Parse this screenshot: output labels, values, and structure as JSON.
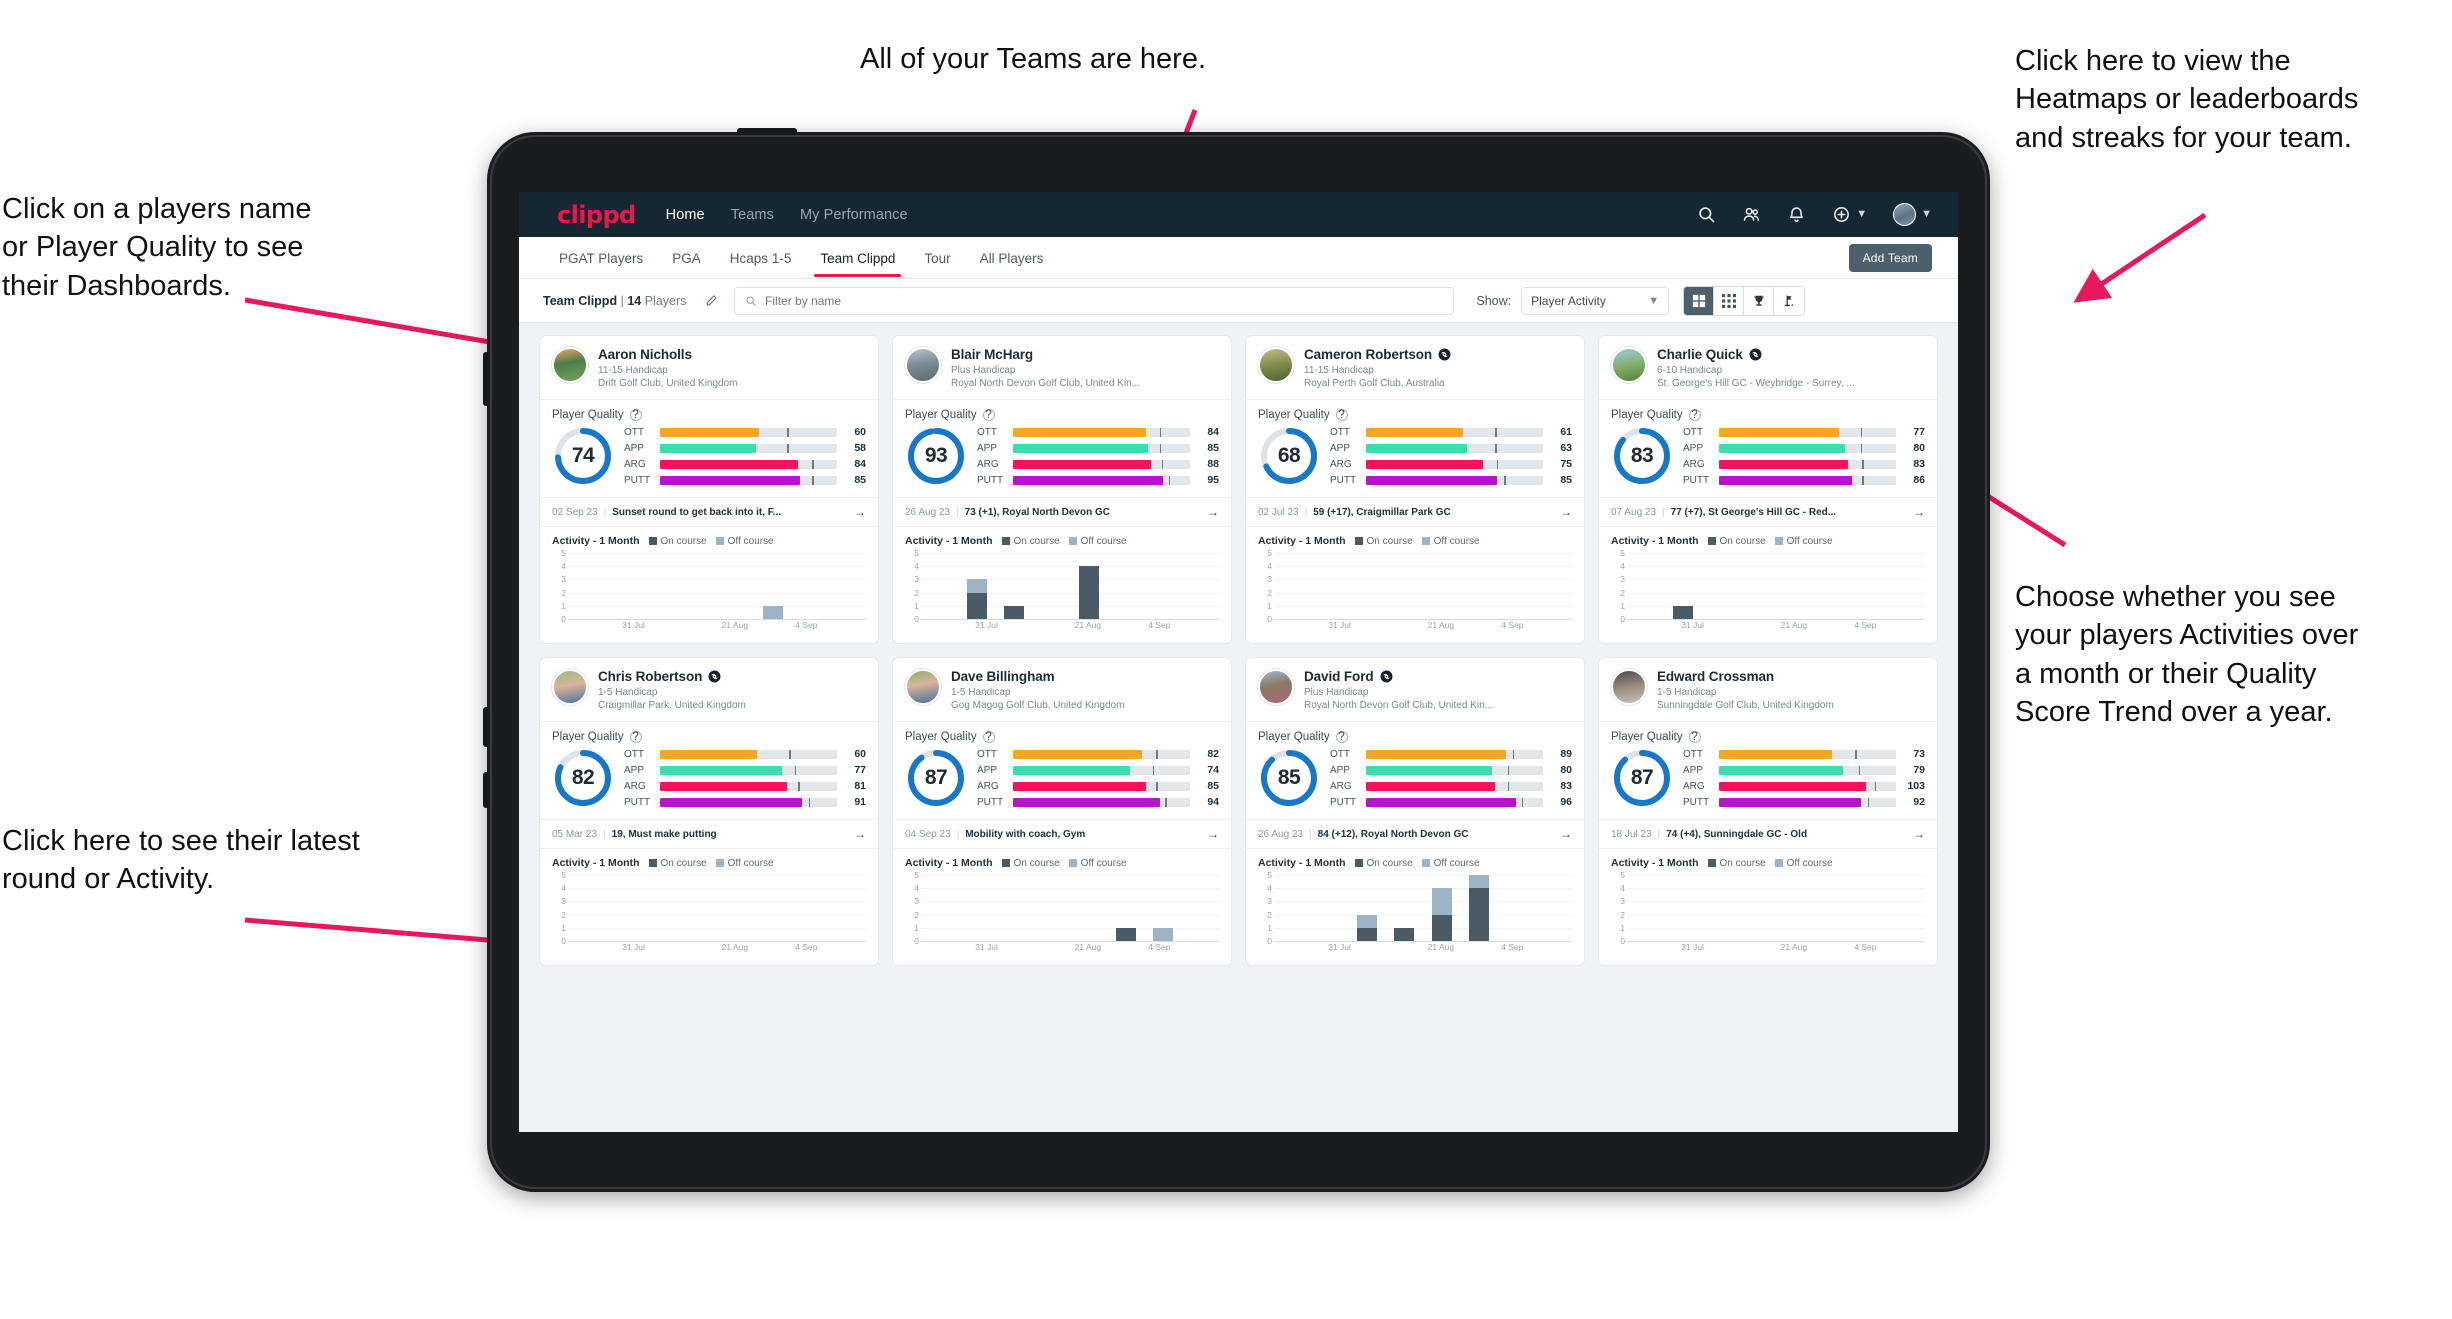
{
  "annotations": [
    {
      "id": "teams",
      "text": "All of your Teams are here."
    },
    {
      "id": "heatmaps",
      "text": "Click here to view the\nHeatmaps or leaderboards\nand streaks for your team."
    },
    {
      "id": "dashboards",
      "text": "Click on a players name\nor Player Quality to see\ntheir Dashboards."
    },
    {
      "id": "show-toggle",
      "text": "Choose whether you see\nyour players Activities over\na month or their Quality\nScore Trend over a year."
    },
    {
      "id": "latest-round",
      "text": "Click here to see their latest\nround or Activity."
    }
  ],
  "colors": {
    "brand": "#e8174c",
    "navbar": "#152733",
    "ott": "#f5a623",
    "app": "#3ddcb0",
    "arg": "#f4145c",
    "putt": "#b316c9",
    "ring": "#1878c8",
    "on_course": "#4a5b66",
    "off_course": "#9db4c6"
  },
  "navbar": {
    "brand": "clippd",
    "links": [
      {
        "label": "Home",
        "active": true
      },
      {
        "label": "Teams",
        "active": false
      },
      {
        "label": "My Performance",
        "active": false
      }
    ],
    "icons": [
      "search-icon",
      "people-icon",
      "bell-icon",
      "plus-circle-icon",
      "avatar"
    ]
  },
  "tabs": [
    {
      "label": "PGAT Players",
      "active": false
    },
    {
      "label": "PGA",
      "active": false
    },
    {
      "label": "Hcaps 1-5",
      "active": false
    },
    {
      "label": "Team Clippd",
      "active": true
    },
    {
      "label": "Tour",
      "active": false
    },
    {
      "label": "All Players",
      "active": false
    }
  ],
  "add_team_label": "Add Team",
  "filterbar": {
    "team_name": "Team Clippd",
    "team_divider": "|",
    "player_count": "14",
    "players_word": "Players",
    "edit_icon": "pencil-icon",
    "search_placeholder": "Filter by name",
    "search_value": "",
    "show_label": "Show:",
    "show_value": "Player Activity",
    "show_options": [
      "Player Activity",
      "Quality Score Trend"
    ],
    "view_buttons": [
      {
        "icon": "grid-large-icon",
        "active": true
      },
      {
        "icon": "grid-dense-icon",
        "active": false
      },
      {
        "icon": "trophy-icon",
        "active": false
      },
      {
        "icon": "heatmap-flag-icon",
        "active": false
      }
    ]
  },
  "card_labels": {
    "player_quality": "Player Quality",
    "help_glyph": "?",
    "activity_title": "Activity - 1 Month",
    "legend_on": "On course",
    "legend_off": "Off course",
    "arrow_glyph": "→"
  },
  "chart_data": {
    "type": "bar",
    "title": "Activity - 1 Month",
    "ylim": [
      0,
      5
    ],
    "yticks": [
      "0",
      "1",
      "2",
      "3",
      "4",
      "5"
    ],
    "xticks": [
      "31 Jul",
      "21 Aug",
      "4 Sep"
    ],
    "legend": [
      "On course",
      "Off course"
    ],
    "grid": true,
    "stacked": true,
    "per_player": [
      {
        "player": "Aaron Nicholls",
        "bins": 8,
        "on": [
          0,
          0,
          0,
          0,
          0,
          0,
          0,
          0
        ],
        "off": [
          0,
          0,
          0,
          0,
          0,
          1,
          0,
          0
        ]
      },
      {
        "player": "Blair McHarg",
        "bins": 8,
        "on": [
          0,
          2,
          1,
          0,
          4,
          0,
          0,
          0
        ],
        "off": [
          0,
          1,
          0,
          0,
          0,
          0,
          0,
          0
        ]
      },
      {
        "player": "Cameron Robertson",
        "bins": 8,
        "on": [
          0,
          0,
          0,
          0,
          0,
          0,
          0,
          0
        ],
        "off": [
          0,
          0,
          0,
          0,
          0,
          0,
          0,
          0
        ]
      },
      {
        "player": "Charlie Quick",
        "bins": 8,
        "on": [
          0,
          1,
          0,
          0,
          0,
          0,
          0,
          0
        ],
        "off": [
          0,
          0,
          0,
          0,
          0,
          0,
          0,
          0
        ]
      },
      {
        "player": "Chris Robertson",
        "bins": 8,
        "on": [
          0,
          0,
          0,
          0,
          0,
          0,
          0,
          0
        ],
        "off": [
          0,
          0,
          0,
          0,
          0,
          0,
          0,
          0
        ]
      },
      {
        "player": "Dave Billingham",
        "bins": 8,
        "on": [
          0,
          0,
          0,
          0,
          0,
          1,
          0,
          0
        ],
        "off": [
          0,
          0,
          0,
          0,
          0,
          0,
          1,
          0
        ]
      },
      {
        "player": "David Ford",
        "bins": 8,
        "on": [
          0,
          0,
          1,
          1,
          2,
          4,
          0,
          0
        ],
        "off": [
          0,
          0,
          1,
          0,
          2,
          1,
          0,
          0
        ]
      },
      {
        "player": "Edward Crossman",
        "bins": 8,
        "on": [
          0,
          0,
          0,
          0,
          0,
          0,
          0,
          0
        ],
        "off": [
          0,
          0,
          0,
          0,
          0,
          0,
          0,
          0
        ]
      }
    ]
  },
  "players": [
    {
      "name": "Aaron Nicholls",
      "verified": false,
      "avatar": "av1",
      "handicap": "11-15 Handicap",
      "club": "Drift Golf Club, United Kingdom",
      "score": 74,
      "ring_pct": 74,
      "metrics": [
        {
          "label": "OTT",
          "value": 60,
          "fill": 56,
          "tick": 72
        },
        {
          "label": "APP",
          "value": 58,
          "fill": 54,
          "tick": 72
        },
        {
          "label": "ARG",
          "value": 84,
          "fill": 78,
          "tick": 86
        },
        {
          "label": "PUTT",
          "value": 85,
          "fill": 79,
          "tick": 86
        }
      ],
      "latest_date": "02 Sep 23",
      "latest_text": "Sunset round to get back into it, F..."
    },
    {
      "name": "Blair McHarg",
      "verified": false,
      "avatar": "av2",
      "handicap": "Plus Handicap",
      "club": "Royal North Devon Golf Club, United Kin...",
      "score": 93,
      "ring_pct": 97,
      "metrics": [
        {
          "label": "OTT",
          "value": 84,
          "fill": 75,
          "tick": 83
        },
        {
          "label": "APP",
          "value": 85,
          "fill": 76,
          "tick": 83
        },
        {
          "label": "ARG",
          "value": 88,
          "fill": 78,
          "tick": 84
        },
        {
          "label": "PUTT",
          "value": 95,
          "fill": 85,
          "tick": 88
        }
      ],
      "latest_date": "26 Aug 23",
      "latest_text": "73 (+1), Royal North Devon GC"
    },
    {
      "name": "Cameron Robertson",
      "verified": true,
      "avatar": "av3",
      "handicap": "11-15 Handicap",
      "club": "Royal Perth Golf Club, Australia",
      "score": 68,
      "ring_pct": 68,
      "metrics": [
        {
          "label": "OTT",
          "value": 61,
          "fill": 55,
          "tick": 73
        },
        {
          "label": "APP",
          "value": 63,
          "fill": 57,
          "tick": 73
        },
        {
          "label": "ARG",
          "value": 75,
          "fill": 66,
          "tick": 74
        },
        {
          "label": "PUTT",
          "value": 85,
          "fill": 74,
          "tick": 78
        }
      ],
      "latest_date": "02 Jul 23",
      "latest_text": "59 (+17), Craigmillar Park GC"
    },
    {
      "name": "Charlie Quick",
      "verified": true,
      "avatar": "av4",
      "handicap": "6-10 Handicap",
      "club": "St. George's Hill GC - Weybridge - Surrey, ...",
      "score": 83,
      "ring_pct": 86,
      "metrics": [
        {
          "label": "OTT",
          "value": 77,
          "fill": 68,
          "tick": 80
        },
        {
          "label": "APP",
          "value": 80,
          "fill": 71,
          "tick": 80
        },
        {
          "label": "ARG",
          "value": 83,
          "fill": 73,
          "tick": 81
        },
        {
          "label": "PUTT",
          "value": 86,
          "fill": 75,
          "tick": 81
        }
      ],
      "latest_date": "07 Aug 23",
      "latest_text": "77 (+7), St George's Hill GC - Red..."
    },
    {
      "name": "Chris Robertson",
      "verified": true,
      "avatar": "av5",
      "handicap": "1-5 Handicap",
      "club": "Craigmillar Park, United Kingdom",
      "score": 82,
      "ring_pct": 82,
      "metrics": [
        {
          "label": "OTT",
          "value": 60,
          "fill": 55,
          "tick": 73
        },
        {
          "label": "APP",
          "value": 77,
          "fill": 69,
          "tick": 76
        },
        {
          "label": "ARG",
          "value": 81,
          "fill": 72,
          "tick": 78
        },
        {
          "label": "PUTT",
          "value": 91,
          "fill": 80,
          "tick": 84
        }
      ],
      "latest_date": "05 Mar 23",
      "latest_text": "19, Must make putting"
    },
    {
      "name": "Dave Billingham",
      "verified": false,
      "avatar": "av6",
      "handicap": "1-5 Handicap",
      "club": "Gog Magog Golf Club, United Kingdom",
      "score": 87,
      "ring_pct": 90,
      "metrics": [
        {
          "label": "OTT",
          "value": 82,
          "fill": 73,
          "tick": 81
        },
        {
          "label": "APP",
          "value": 74,
          "fill": 66,
          "tick": 79
        },
        {
          "label": "ARG",
          "value": 85,
          "fill": 75,
          "tick": 81
        },
        {
          "label": "PUTT",
          "value": 94,
          "fill": 83,
          "tick": 86
        }
      ],
      "latest_date": "04 Sep 23",
      "latest_text": "Mobility with coach, Gym"
    },
    {
      "name": "David Ford",
      "verified": true,
      "avatar": "av7",
      "handicap": "Plus Handicap",
      "club": "Royal North Devon Golf Club, United Kin...",
      "score": 85,
      "ring_pct": 88,
      "metrics": [
        {
          "label": "OTT",
          "value": 89,
          "fill": 79,
          "tick": 83
        },
        {
          "label": "APP",
          "value": 80,
          "fill": 71,
          "tick": 80
        },
        {
          "label": "ARG",
          "value": 83,
          "fill": 73,
          "tick": 80
        },
        {
          "label": "PUTT",
          "value": 96,
          "fill": 85,
          "tick": 88
        }
      ],
      "latest_date": "26 Aug 23",
      "latest_text": "84 (+12), Royal North Devon GC"
    },
    {
      "name": "Edward Crossman",
      "verified": false,
      "avatar": "av8",
      "handicap": "1-5 Handicap",
      "club": "Sunningdale Golf Club, United Kingdom",
      "score": 87,
      "ring_pct": 88,
      "metrics": [
        {
          "label": "OTT",
          "value": 73,
          "fill": 64,
          "tick": 77
        },
        {
          "label": "APP",
          "value": 79,
          "fill": 70,
          "tick": 79
        },
        {
          "label": "ARG",
          "value": 103,
          "fill": 83,
          "tick": 88
        },
        {
          "label": "PUTT",
          "value": 92,
          "fill": 80,
          "tick": 84
        }
      ],
      "latest_date": "18 Jul 23",
      "latest_text": "74 (+4), Sunningdale GC - Old"
    }
  ]
}
